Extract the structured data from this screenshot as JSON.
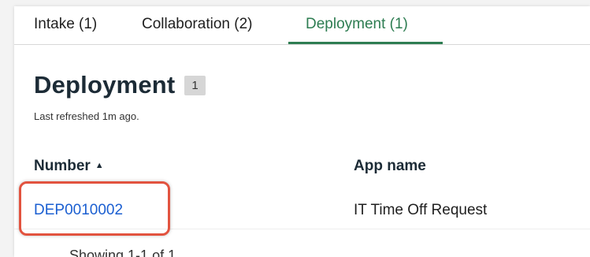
{
  "tabs": [
    {
      "label": "Intake (1)"
    },
    {
      "label": "Collaboration (2)"
    },
    {
      "label": "Deployment (1)"
    }
  ],
  "header": {
    "title": "Deployment",
    "count": "1",
    "refreshed": "Last refreshed 1m ago."
  },
  "table": {
    "columns": [
      {
        "label": "Number",
        "sort": "ascending"
      },
      {
        "label": "App name"
      }
    ],
    "rows": [
      {
        "number": "DEP0010002",
        "app_name": "IT Time Off Request"
      }
    ]
  },
  "pager": {
    "text": "Showing 1-1 of 1"
  },
  "colors": {
    "active_tab": "#2e7d52",
    "link": "#1b5fd1",
    "highlight": "#e2533f"
  },
  "icons": {
    "sort": "caret-up-icon"
  }
}
